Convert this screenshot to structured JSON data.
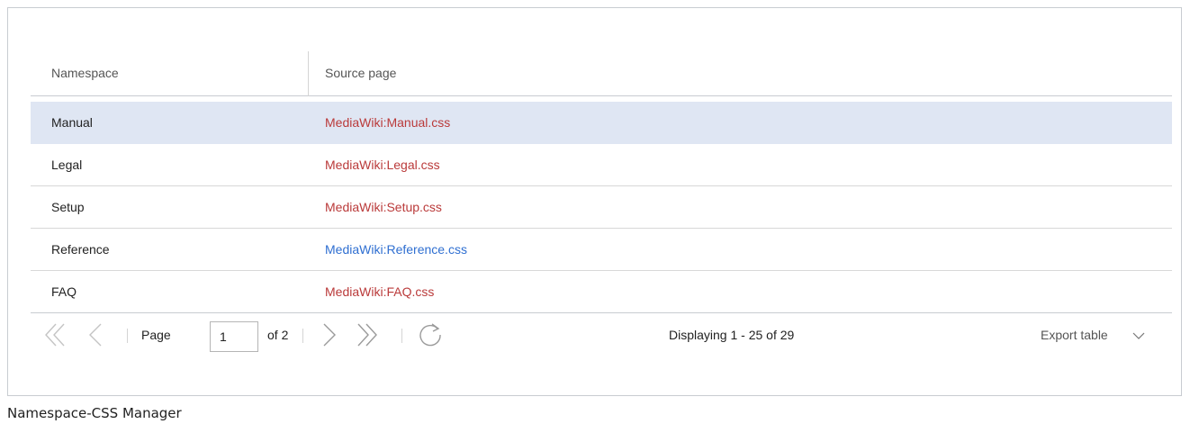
{
  "table": {
    "columns": [
      "Namespace",
      "Source page"
    ],
    "rows": [
      {
        "namespace": "Manual",
        "source": "MediaWiki:Manual.css",
        "link_color": "#ba3a3a"
      },
      {
        "namespace": "Legal",
        "source": "MediaWiki:Legal.css",
        "link_color": "#ba3a3a"
      },
      {
        "namespace": "Setup",
        "source": "MediaWiki:Setup.css",
        "link_color": "#ba3a3a"
      },
      {
        "namespace": "Reference",
        "source": "MediaWiki:Reference.css",
        "link_color": "#2f6fd1"
      },
      {
        "namespace": "FAQ",
        "source": "MediaWiki:FAQ.css",
        "link_color": "#ba3a3a"
      }
    ],
    "selected_row": 0
  },
  "pager": {
    "page_label": "Page",
    "page_value": "1",
    "of_label": "of 2",
    "display_text": "Displaying 1 - 25 of 29",
    "export_label": "Export table",
    "icons": [
      "first-page-icon",
      "prev-page-icon",
      "next-page-icon",
      "last-page-icon",
      "refresh-icon",
      "chevron-down-icon"
    ]
  },
  "caption": "Namespace-CSS Manager",
  "colors": {
    "selected_row": "#dfe6f3",
    "redlink": "#ba3a3a",
    "link": "#2f6fd1",
    "border": "#c8ccd1"
  }
}
